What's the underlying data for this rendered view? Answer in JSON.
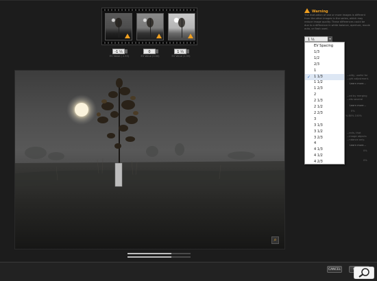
{
  "thumbnails": [
    {
      "tone": "dark",
      "warning": true
    },
    {
      "tone": "mid",
      "warning": true
    },
    {
      "tone": "light",
      "warning": true
    }
  ],
  "ev_controls": [
    {
      "value": "-1 ⅓"
    },
    {
      "value": "0"
    },
    {
      "value": "1 ⅓"
    }
  ],
  "ev_captions": [
    "EV Value (-1.33)",
    "EV Value (0.00)",
    "EV Value (1.33)"
  ],
  "warning": {
    "title": "Warning",
    "text": "The evaluation of one or more images is different from the other images in the series, which may reduce image quality. These differences could be due to a difference in white balance, aperture, movie auto, or flash used."
  },
  "ev_select": {
    "value": "1 ⅓"
  },
  "ev_options": [
    "EV Spacing",
    "1/3",
    "1/2",
    "2/3",
    "1",
    "1 1/3",
    "1 1/2",
    "1 2/3",
    "2",
    "2 1/3",
    "2 1/2",
    "2 2/3",
    "3",
    "3 1/3",
    "3 1/2",
    "3 2/3",
    "4",
    "4 1/3",
    "4 1/2",
    "4 2/3"
  ],
  "ev_selected_index": 5,
  "panel_ghost": {
    "line_a": "...ality, useful for",
    "line_b": "...ght adjustment.",
    "link_a": "Learn more...",
    "line_c": "...ed by merging",
    "line_d": "...ets several",
    "link_b": "Learn more...",
    "val_0": "0%",
    "pct_60": "% 80% 100%",
    "line_e": "...ects, that",
    "line_f": "...image objects",
    "line_g": "...ndance only.",
    "link_c": "Learn more...",
    "val_1": "0%",
    "val_2": "0%"
  },
  "buttons": {
    "cancel": "CANCEL",
    "create": "CREATE"
  },
  "sliders": [
    {
      "fill": 0.7
    },
    {
      "fill": 0.7
    }
  ]
}
